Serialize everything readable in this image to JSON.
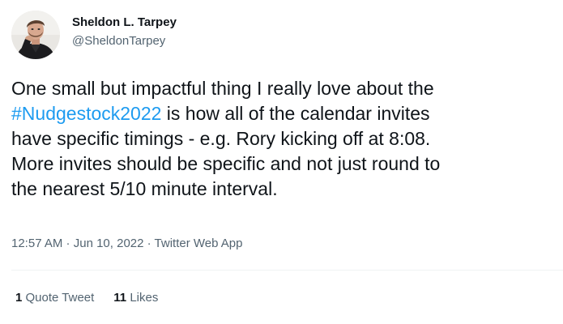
{
  "tweet": {
    "author": {
      "display_name": "Sheldon L. Tarpey",
      "handle": "@SheldonTarpey",
      "avatar_icon": "profile-photo"
    },
    "text": {
      "before": "One small but impactful thing I really love about the ",
      "hashtag": "#Nudgestock2022",
      "after": " is how all of the calendar invites have specific timings - e.g. Rory kicking off at 8:08. More invites should be specific and not just round to the nearest 5/10 minute interval."
    },
    "meta": {
      "time": "12:57 AM",
      "separator1": " · ",
      "date": "Jun 10, 2022",
      "separator2": " · ",
      "source": "Twitter Web App"
    },
    "stats": {
      "quote_count": "1",
      "quote_label": "Quote Tweet",
      "likes_count": "11",
      "likes_label": "Likes"
    }
  },
  "colors": {
    "text_primary": "#0f1419",
    "text_secondary": "#536471",
    "link_blue": "#1d9bf0",
    "divider": "#eff3f4"
  }
}
